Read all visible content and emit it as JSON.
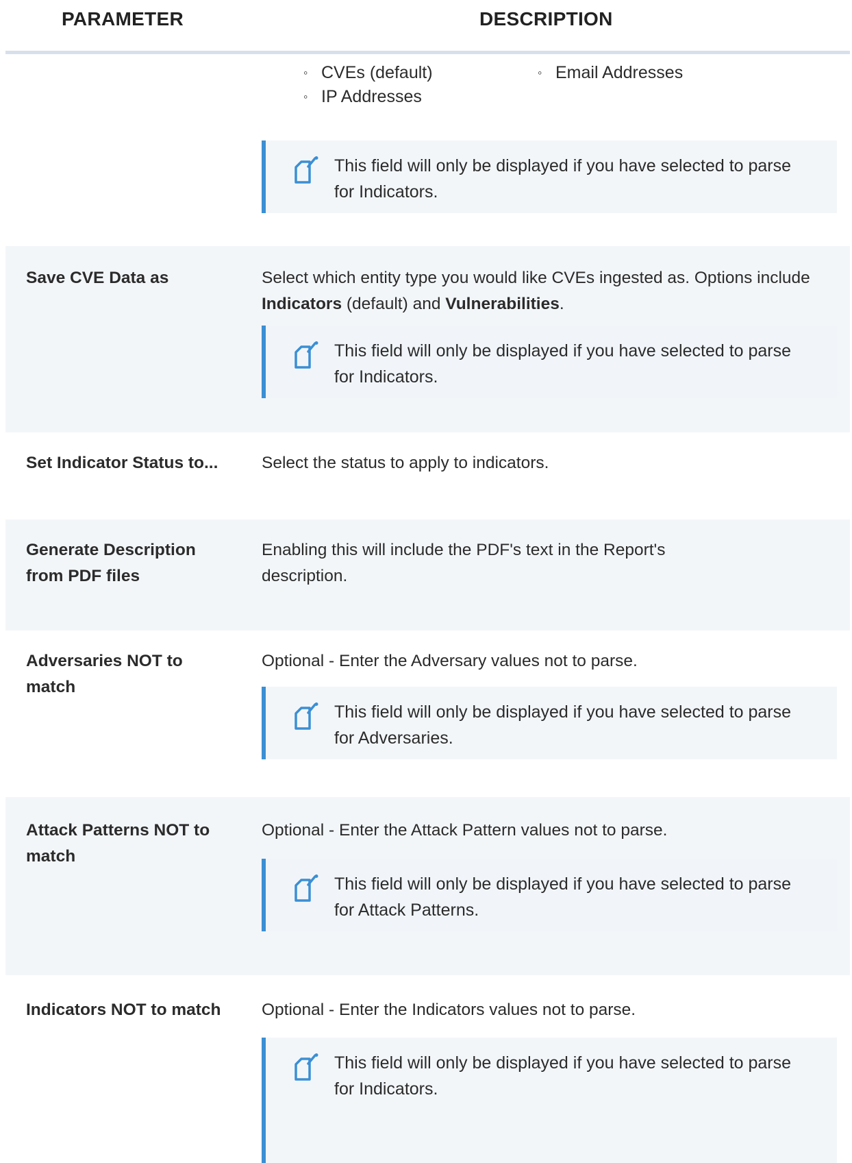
{
  "header": {
    "parameter": "PARAMETER",
    "description": "DESCRIPTION"
  },
  "top_bullets": [
    "CVEs (default)",
    "Email Addresses",
    "IP Addresses"
  ],
  "rows": [
    {
      "param": "",
      "note": "This field will only be displayed if you have selected to parse for Indicators."
    },
    {
      "param": "Save CVE Data as",
      "desc_pre": "Select which entity type you would like CVEs ingested as. Options include ",
      "desc_b1": "Indicators",
      "desc_mid": " (default) and ",
      "desc_b2": "Vulnerabilities",
      "desc_post": ".",
      "note": "This field will only be displayed if you have selected to parse for Indicators."
    },
    {
      "param": "Set Indicator Status to...",
      "desc": "Select the status to apply to indicators."
    },
    {
      "param": "Generate Description from PDF files",
      "desc": "Enabling this will include the PDF's text in the Report's description."
    },
    {
      "param": "Adversaries NOT to match",
      "desc": "Optional - Enter the Adversary values not to parse.",
      "note": "This field will only be displayed if you have selected to parse for Adversaries."
    },
    {
      "param": "Attack Patterns NOT to match",
      "desc": "Optional - Enter the Attack Pattern values not to parse.",
      "note": "This field will only be displayed if you have selected to parse for Attack Patterns."
    },
    {
      "param": "Indicators NOT to match",
      "desc": "Optional - Enter the Indicators values not to parse.",
      "note": "This field will only be displayed if you have selected to parse for Indicators."
    }
  ],
  "icons": {
    "note": "note-pencil-icon",
    "bullet": "hollow-circle-bullet"
  },
  "colors": {
    "accent": "#3b8fd4",
    "row_alt": "#f3f6f9",
    "header_rule": "#d7e0ea"
  }
}
